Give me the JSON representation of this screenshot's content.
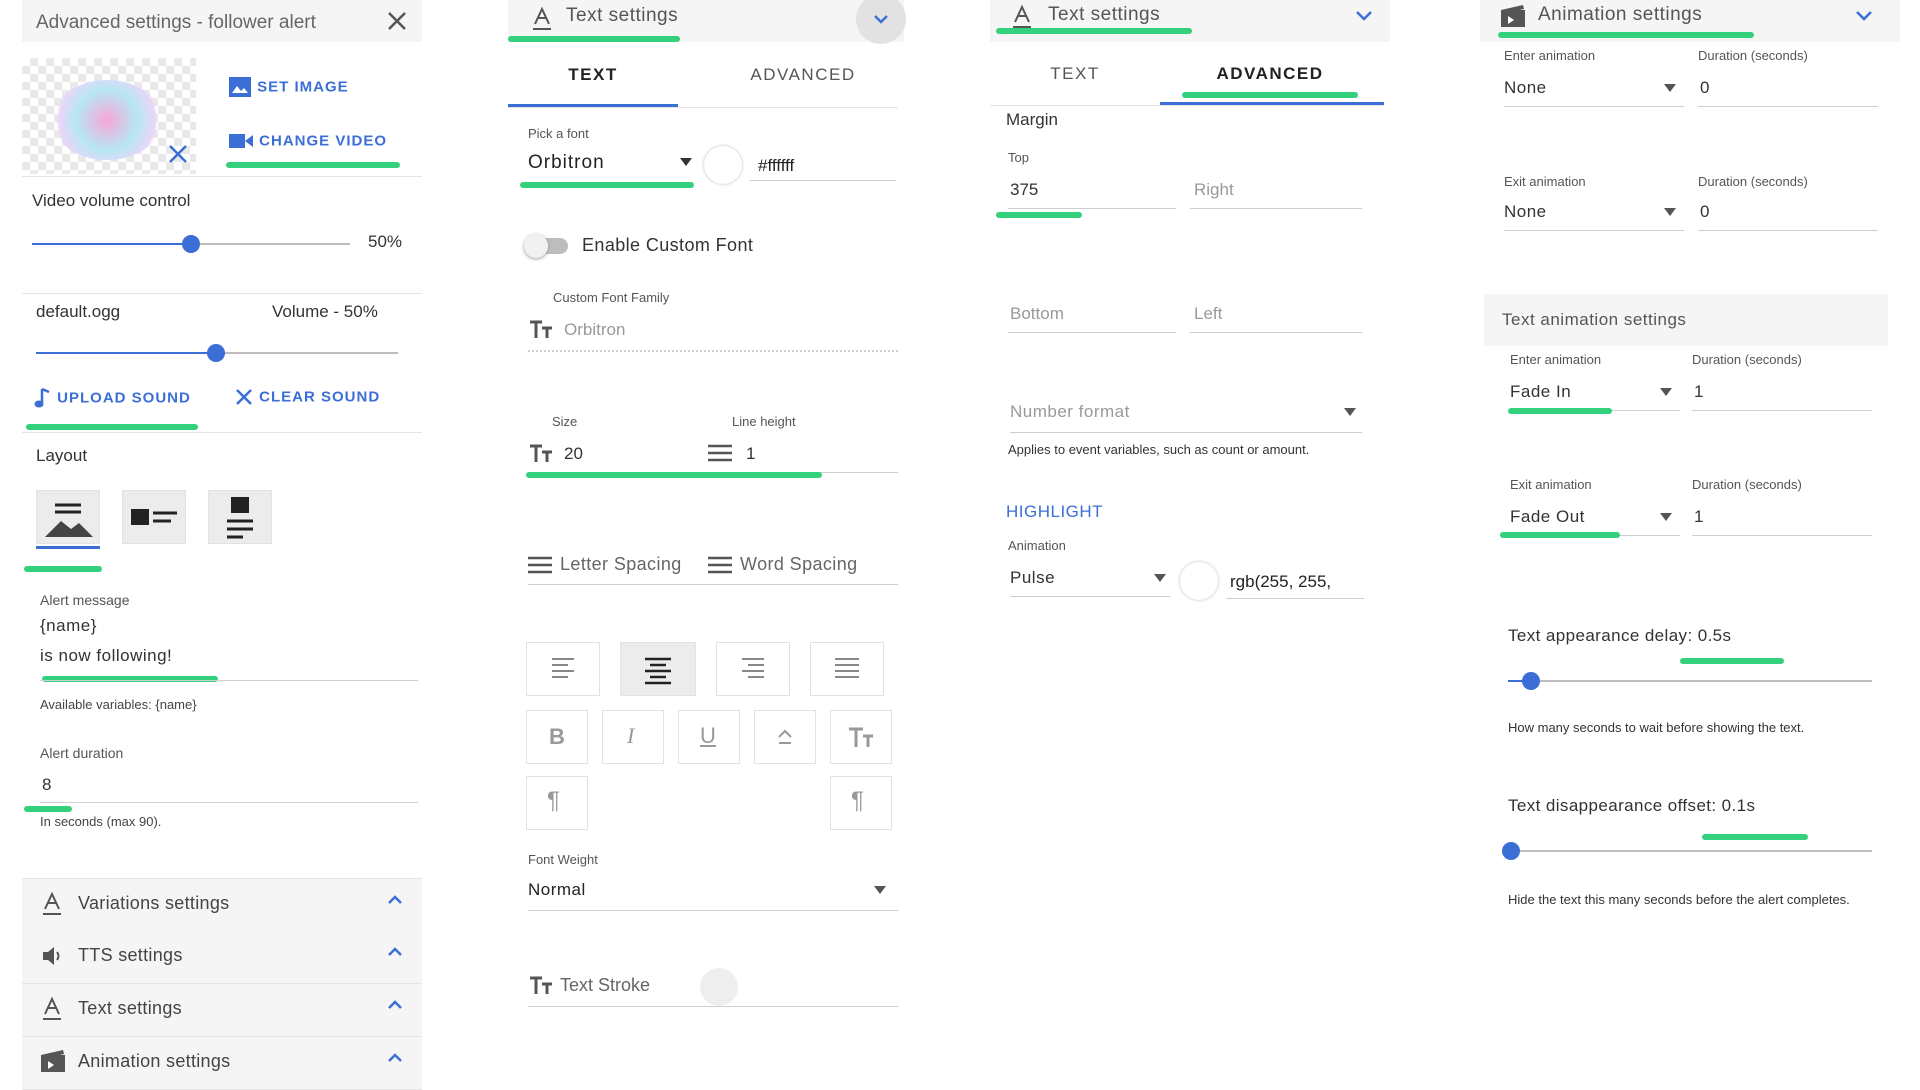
{
  "panel1": {
    "title": "Advanced settings - follower alert",
    "set_image": "SET IMAGE",
    "change_video": "CHANGE VIDEO",
    "video_volume_label": "Video volume control",
    "video_volume_value": "50%",
    "video_volume_fraction": 0.5,
    "sound_file": "default.ogg",
    "sound_volume": "Volume - 50%",
    "sound_volume_fraction": 0.5,
    "upload_sound": "UPLOAD SOUND",
    "clear_sound": "CLEAR SOUND",
    "layout_label": "Layout",
    "alert_message_label": "Alert message",
    "alert_message_line1": "{name}",
    "alert_message_line2": "is now following!",
    "available_vars": "Available variables: {name}",
    "alert_duration_label": "Alert duration",
    "alert_duration_value": "8",
    "alert_duration_help": "In seconds (max 90).",
    "sections": [
      {
        "label": "Variations settings",
        "icon": "text-format-icon"
      },
      {
        "label": "TTS settings",
        "icon": "speaker-icon"
      },
      {
        "label": "Text settings",
        "icon": "text-format-icon"
      },
      {
        "label": "Animation settings",
        "icon": "movie-icon"
      }
    ]
  },
  "panel2": {
    "title": "Text settings",
    "tab_text": "TEXT",
    "tab_advanced": "ADVANCED",
    "pick_font_label": "Pick a font",
    "font_value": "Orbitron",
    "color_value": "#ffffff",
    "enable_custom_font": "Enable Custom Font",
    "custom_font_family_label": "Custom Font Family",
    "custom_font_family_placeholder": "Orbitron",
    "size_label": "Size",
    "size_value": "20",
    "line_height_label": "Line height",
    "line_height_value": "1",
    "letter_spacing": "Letter Spacing",
    "word_spacing": "Word Spacing",
    "font_weight_label": "Font Weight",
    "font_weight_value": "Normal",
    "text_stroke": "Text Stroke"
  },
  "panel3": {
    "title": "Text settings",
    "tab_text": "TEXT",
    "tab_advanced": "ADVANCED",
    "margin_label": "Margin",
    "top_label": "Top",
    "top_value": "375",
    "right_placeholder": "Right",
    "bottom_placeholder": "Bottom",
    "left_placeholder": "Left",
    "number_format_placeholder": "Number format",
    "number_format_help": "Applies to event variables, such as count or amount.",
    "highlight_label": "HIGHLIGHT",
    "animation_label": "Animation",
    "animation_value": "Pulse",
    "highlight_color": "rgb(255, 255,"
  },
  "panel4": {
    "title": "Animation settings",
    "enter_animation_label": "Enter animation",
    "enter_animation_value": "None",
    "enter_duration_label": "Duration (seconds)",
    "enter_duration_value": "0",
    "exit_animation_label": "Exit animation",
    "exit_animation_value": "None",
    "exit_duration_label": "Duration (seconds)",
    "exit_duration_value": "0",
    "text_animation_header": "Text animation settings",
    "text_enter_label": "Enter animation",
    "text_enter_value": "Fade In",
    "text_enter_duration_label": "Duration (seconds)",
    "text_enter_duration_value": "1",
    "text_exit_label": "Exit animation",
    "text_exit_value": "Fade Out",
    "text_exit_duration_label": "Duration (seconds)",
    "text_exit_duration_value": "1",
    "appearance_delay_label": "Text appearance delay: 0.5s",
    "appearance_delay_fraction": 0.05,
    "appearance_delay_help": "How many seconds to wait before showing the text.",
    "disappearance_offset_label": "Text disappearance offset: 0.1s",
    "disappearance_offset_fraction": 0.0,
    "disappearance_offset_help": "Hide the text this many seconds before the alert completes."
  },
  "colors": {
    "accent_blue": "#3b6fd6",
    "highlight_green": "#34d17c",
    "header_bg": "#f5f5f5"
  }
}
